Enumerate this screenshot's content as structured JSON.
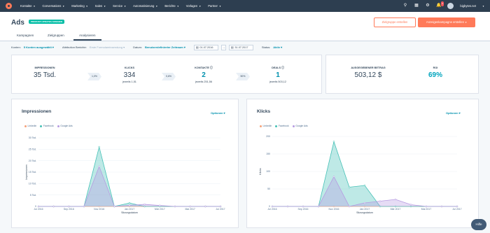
{
  "nav": {
    "items": [
      "Kontakte",
      "Conversations",
      "Marketing",
      "Sales",
      "Service",
      "Automatisierung",
      "Berichte",
      "Vorlagen",
      "Partner"
    ],
    "notification_count": "3",
    "account": "bigbytes.net"
  },
  "header": {
    "title": "Ads",
    "tag": "PRODUKT-UPDATES ANSEHEN",
    "secondary_button": "Zielgruppe erstellen",
    "primary_button": "Anzeigenkampagne erstellen"
  },
  "tabs": [
    "Kampagnen",
    "Zielgruppen",
    "Analysieren"
  ],
  "filters": {
    "konten_label": "Konten:",
    "konten_value": "5 Konten ausgewählt",
    "attribution_label": "Attribution Berichte:",
    "attribution_value": "Erste Formulareinsendung",
    "datum_label": "Datum:",
    "datum_value": "Benutzerdefinierter Zeitraum",
    "date_from": "01.07.2016",
    "date_to": "31.07.2017",
    "status_label": "Status:",
    "status_value": "Aktiv"
  },
  "kpis": {
    "impressions": {
      "label": "IMPRESSIONEN",
      "value": "35 Tsd."
    },
    "rate1": "1,0%",
    "clicks": {
      "label": "KLICKS",
      "value": "334",
      "sub": "jeweils 1,51"
    },
    "rate2": "0,6%",
    "contacts": {
      "label": "KONTAKTE",
      "value": "2",
      "sub": "jeweils 251,56"
    },
    "rate3": "50%",
    "deals": {
      "label": "DEALS",
      "value": "1",
      "sub": "jeweils 503,12"
    },
    "spend": {
      "label": "AUSGEGEBENER BETRAG",
      "value": "503,12 $"
    },
    "roi": {
      "label": "ROI",
      "value": "69%"
    }
  },
  "charts": {
    "options_label": "Optionen",
    "colors": {
      "LinkedIn": "#f5a27a",
      "Facebook": "#45c1b6",
      "Google Ads": "#b69be1"
    }
  },
  "chart_data": [
    {
      "type": "area",
      "title": "Impressionen",
      "xlabel": "Sitzungsdatum",
      "ylabel": "Impressionen",
      "ylim": [
        0,
        30000
      ],
      "yticks": [
        "0",
        "5 Tsd.",
        "10 Tsd.",
        "15 Tsd.",
        "20 Tsd.",
        "25 Tsd.",
        "30 Tsd."
      ],
      "xticks": [
        "Jul 2016",
        "Sep 2016",
        "Nov 2016",
        "Jan 2017",
        "Mär 2017",
        "Mai 2017",
        "Jul 2017"
      ],
      "legend": "top-left",
      "x": [
        "Jul 2016",
        "Aug 2016",
        "Sep 2016",
        "Okt 2016",
        "Nov 2016",
        "Dez 2016",
        "Jan 2017",
        "Feb 2017",
        "Mär 2017",
        "Apr 2017",
        "Mai 2017",
        "Jun 2017",
        "Jul 2017"
      ],
      "series": [
        {
          "name": "LinkedIn",
          "values": [
            0,
            0,
            0,
            0,
            0,
            0,
            0,
            0,
            0,
            0,
            0,
            0,
            0
          ]
        },
        {
          "name": "Facebook",
          "values": [
            0,
            0,
            0,
            0,
            26000,
            0,
            1500,
            0,
            0,
            0,
            0,
            0,
            0
          ]
        },
        {
          "name": "Google Ads",
          "values": [
            0,
            0,
            0,
            0,
            17500,
            0,
            500,
            900,
            400,
            0,
            0,
            0,
            0
          ]
        }
      ]
    },
    {
      "type": "area",
      "title": "Klicks",
      "xlabel": "Sitzungsdatum",
      "ylabel": "Klicks",
      "ylim": [
        0,
        200
      ],
      "yticks": [
        "0",
        "50",
        "100",
        "150",
        "200"
      ],
      "xticks": [
        "Jul 2016",
        "Sep 2016",
        "Nov 2016",
        "Jan 2017",
        "Mär 2017",
        "Mai 2017",
        "Jul 2017"
      ],
      "legend": "top-left",
      "x": [
        "Jul 2016",
        "Aug 2016",
        "Sep 2016",
        "Okt 2016",
        "Nov 2016",
        "Dez 2016",
        "Jan 2017",
        "Feb 2017",
        "Mär 2017",
        "Apr 2017",
        "Mai 2017",
        "Jun 2017",
        "Jul 2017"
      ],
      "series": [
        {
          "name": "LinkedIn",
          "values": [
            0,
            0,
            0,
            0,
            0,
            0,
            0,
            0,
            0,
            0,
            0,
            0,
            0
          ]
        },
        {
          "name": "Facebook",
          "values": [
            0,
            0,
            0,
            0,
            185,
            55,
            60,
            0,
            0,
            0,
            0,
            0,
            0
          ]
        },
        {
          "name": "Google Ads",
          "values": [
            0,
            0,
            0,
            0,
            85,
            0,
            10,
            15,
            20,
            5,
            0,
            0,
            0
          ]
        }
      ]
    }
  ],
  "help_label": "Hilfe"
}
